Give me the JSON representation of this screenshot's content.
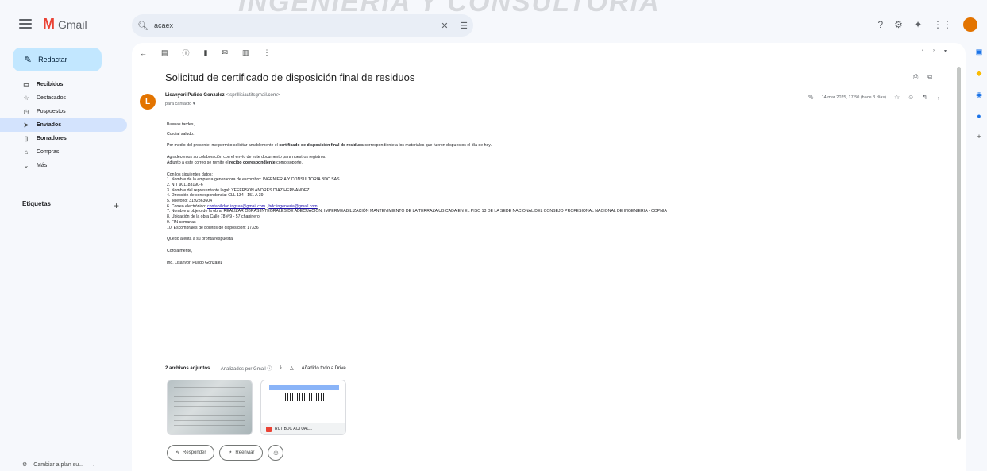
{
  "header": {
    "app_name": "Gmail",
    "logo_letter": "M",
    "search_value": "acaex",
    "avatar_letter": ""
  },
  "watermark": "INGENIERIA Y CONSULTORIA",
  "sidebar": {
    "compose_label": "Redactar",
    "items": [
      {
        "label": "Recibidos",
        "count": "",
        "icon": "inbox-icon"
      },
      {
        "label": "Destacados",
        "count": "",
        "icon": "star-icon"
      },
      {
        "label": "Pospuestos",
        "count": "",
        "icon": "clock-icon"
      },
      {
        "label": "Enviados",
        "count": "",
        "icon": "send-icon"
      },
      {
        "label": "Borradores",
        "count": "",
        "icon": "draft-icon"
      },
      {
        "label": "Compras",
        "count": "",
        "icon": "tag-icon"
      },
      {
        "label": "Más",
        "count": "",
        "icon": "chevron-down-icon"
      }
    ],
    "labels_title": "Etiquetas",
    "switch_label": "Cambiar a plan su..."
  },
  "message": {
    "subject": "Solicitud de certificado de disposición final de residuos",
    "sender_name": "Lisanyori Pulido Gonzalez",
    "sender_email": "<lsprillisiautitsgmail.com>",
    "to_line": "para cantacto ▾",
    "date": "14 mar 2025, 17:50 (hace 3 días)",
    "body": {
      "greeting": "Buenas tardes,",
      "salutation": "Cordial saludo.",
      "p1_pre": "Por medio del presente, me permito solicitar amablemente el ",
      "p1_bold": "certificado de disposición final de residuos",
      "p1_post": " correspondiente a los materiales que fueron dispuestos el día de hoy.",
      "p2": "Agradecemos su colaboración con el envío de este documento para nuestros registros.",
      "p3_pre": "Adjunto a este correo se remite el ",
      "p3_bold": "recibo correspondiente",
      "p3_post": " como soporte.",
      "data_intro": "Con los siguientes datos:",
      "l1": "1. Nombre de la empresa generadora de escombro: INGENIERIA Y CONSULTORIA BDC SAS",
      "l2": "2. NIT 901183190-6",
      "l3": "3. Nombre del representante legal: YEFERSON ANDRÉS DIAZ HERNANDEZ",
      "l4": "4. Dirección de correspondencia: CLL 134 - 151 A 39",
      "l5": "5. Teléfono: 3192863604",
      "l6_pre": "6. Correo electrónico: ",
      "l6_link1": "contabilidad.ingsas@gmail.com",
      "l6_mid": " , ",
      "l6_link2": "bdc.ingenieria@gmail.com",
      "l7": "7. Nombre u objeto de la obra: REALIZAR OBRAS INTEGRALES DE ADECUACIÓN, IMPERMEABILIZACIÓN MANTENIMIENTO DE LA TERRAZA UBICADA EN EL PISO 13 DE LA SEDE NACIONAL DEL CONSEJO PROFESIONAL NACIONAL DE INGENIERIA - COPNIA",
      "l8": "8. Ubicación de la obra Calle 78 # 9 - 57 chapinero",
      "l9": "9. FIN semanas",
      "l10": "10. Escombrales de boletos de disposición: 17336",
      "closing": "Quedo atenta a su pronta respuesta.",
      "regards": "Cordialmente,",
      "signature": "Ing. Lisanyori Pulido González"
    },
    "attachments_title": "2 archivos adjuntos",
    "attachments_sub": "· Analizados por Gmail ⓘ",
    "attachments_drive": "Añadirlo todo a Drive",
    "attachment2_name": "RUT BDC ACTUAL...",
    "reply_label": "Responder",
    "forward_label": "Reenviar"
  }
}
